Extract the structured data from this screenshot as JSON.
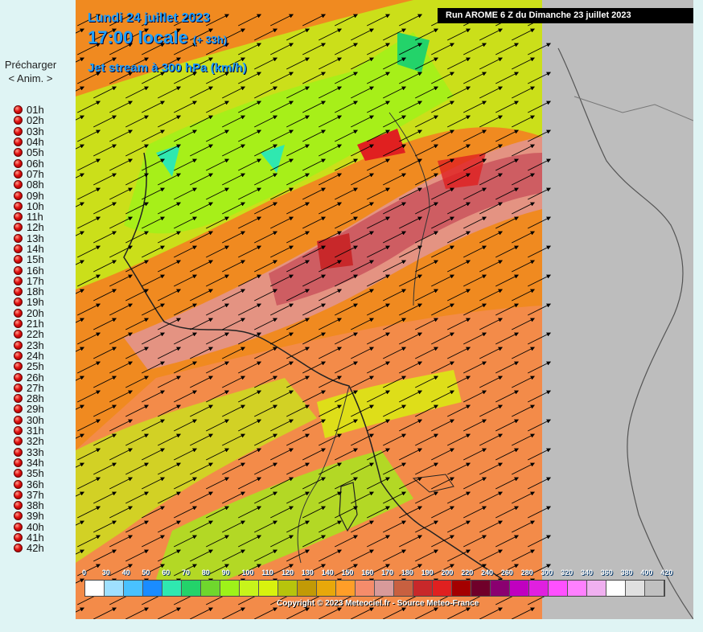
{
  "sidebar": {
    "preload_label": "Précharger",
    "anim_label": "< Anim. >",
    "hours": [
      "01h",
      "02h",
      "03h",
      "04h",
      "05h",
      "06h",
      "07h",
      "08h",
      "09h",
      "10h",
      "11h",
      "12h",
      "13h",
      "14h",
      "15h",
      "16h",
      "17h",
      "18h",
      "19h",
      "20h",
      "21h",
      "22h",
      "23h",
      "24h",
      "25h",
      "26h",
      "27h",
      "28h",
      "29h",
      "30h",
      "31h",
      "32h",
      "33h",
      "34h",
      "35h",
      "36h",
      "37h",
      "38h",
      "39h",
      "40h",
      "41h",
      "42h"
    ]
  },
  "map": {
    "date": "Lundi 24 juillet 2023",
    "time": "17:00 locale",
    "lead": "(+ 33h)",
    "parameter": "Jet stream à 300 hPa (km/h)",
    "run": "Run AROME 6 Z du Dimanche 23 juillet 2023",
    "copyright": "Copyright © 2023 Meteociel.fr - Source Meteo-France"
  },
  "legend": {
    "labels": [
      "0",
      "30",
      "40",
      "50",
      "60",
      "70",
      "80",
      "90",
      "100",
      "110",
      "120",
      "130",
      "140",
      "150",
      "160",
      "170",
      "180",
      "190",
      "200",
      "220",
      "240",
      "260",
      "280",
      "300",
      "320",
      "340",
      "360",
      "380",
      "400",
      "420"
    ],
    "colors": [
      "#ffffff",
      "#9fe0ff",
      "#49c1ff",
      "#1a8cff",
      "#2fe8b0",
      "#23d36a",
      "#6fd72d",
      "#9ef219",
      "#c7f41b",
      "#d8f20e",
      "#b7c40c",
      "#c29a06",
      "#e8a80a",
      "#ff9e28",
      "#f58c6b",
      "#d89a9a",
      "#c86040",
      "#c8282a",
      "#e02020",
      "#a40000",
      "#70002a",
      "#8a0070",
      "#c000c0",
      "#e020e0",
      "#ff50ff",
      "#ff80ff",
      "#f0b0f0",
      "#ffffff",
      "#e0e0e0",
      "#c0c0c0"
    ]
  }
}
